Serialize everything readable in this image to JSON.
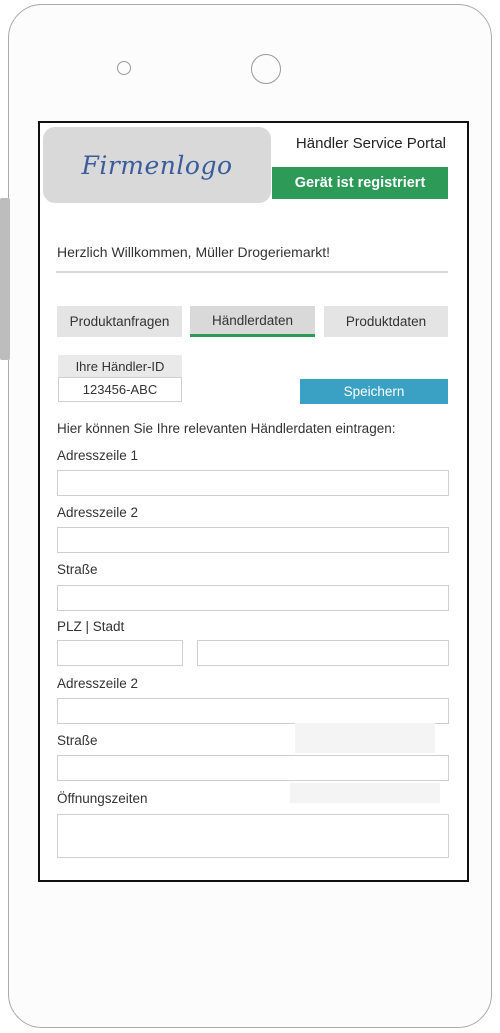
{
  "header": {
    "logo_text": "Firmenlogo",
    "portal_title": "Händler Service Portal",
    "status_badge": "Gerät ist registriert"
  },
  "welcome": "Herzlich Willkommen, Müller Drogeriemarkt!",
  "tabs": [
    {
      "label": "Produktanfragen",
      "active": false
    },
    {
      "label": "Händlerdaten",
      "active": true
    },
    {
      "label": "Produktdaten",
      "active": false
    }
  ],
  "dealer_id": {
    "label": "Ihre Händler-ID",
    "value": "123456-ABC"
  },
  "save_button": "Speichern",
  "intro_text": "Hier können Sie Ihre relevanten Händlerdaten eintragen:",
  "fields": {
    "address1": {
      "label": "Adresszeile 1",
      "value": ""
    },
    "address2": {
      "label": "Adresszeile 2",
      "value": ""
    },
    "street": {
      "label": "Straße",
      "value": ""
    },
    "plz_city": {
      "label": "PLZ | Stadt",
      "plz_value": "",
      "city_value": ""
    },
    "address2_repeat": {
      "label": "Adresszeile 2",
      "value": ""
    },
    "street_repeat": {
      "label": "Straße",
      "value": ""
    },
    "opening_hours": {
      "label": "Öffnungszeiten",
      "value": ""
    }
  },
  "colors": {
    "accent_green": "#2e9a58",
    "save_blue": "#3aa0c4",
    "logo_text": "#3a5b9c"
  }
}
